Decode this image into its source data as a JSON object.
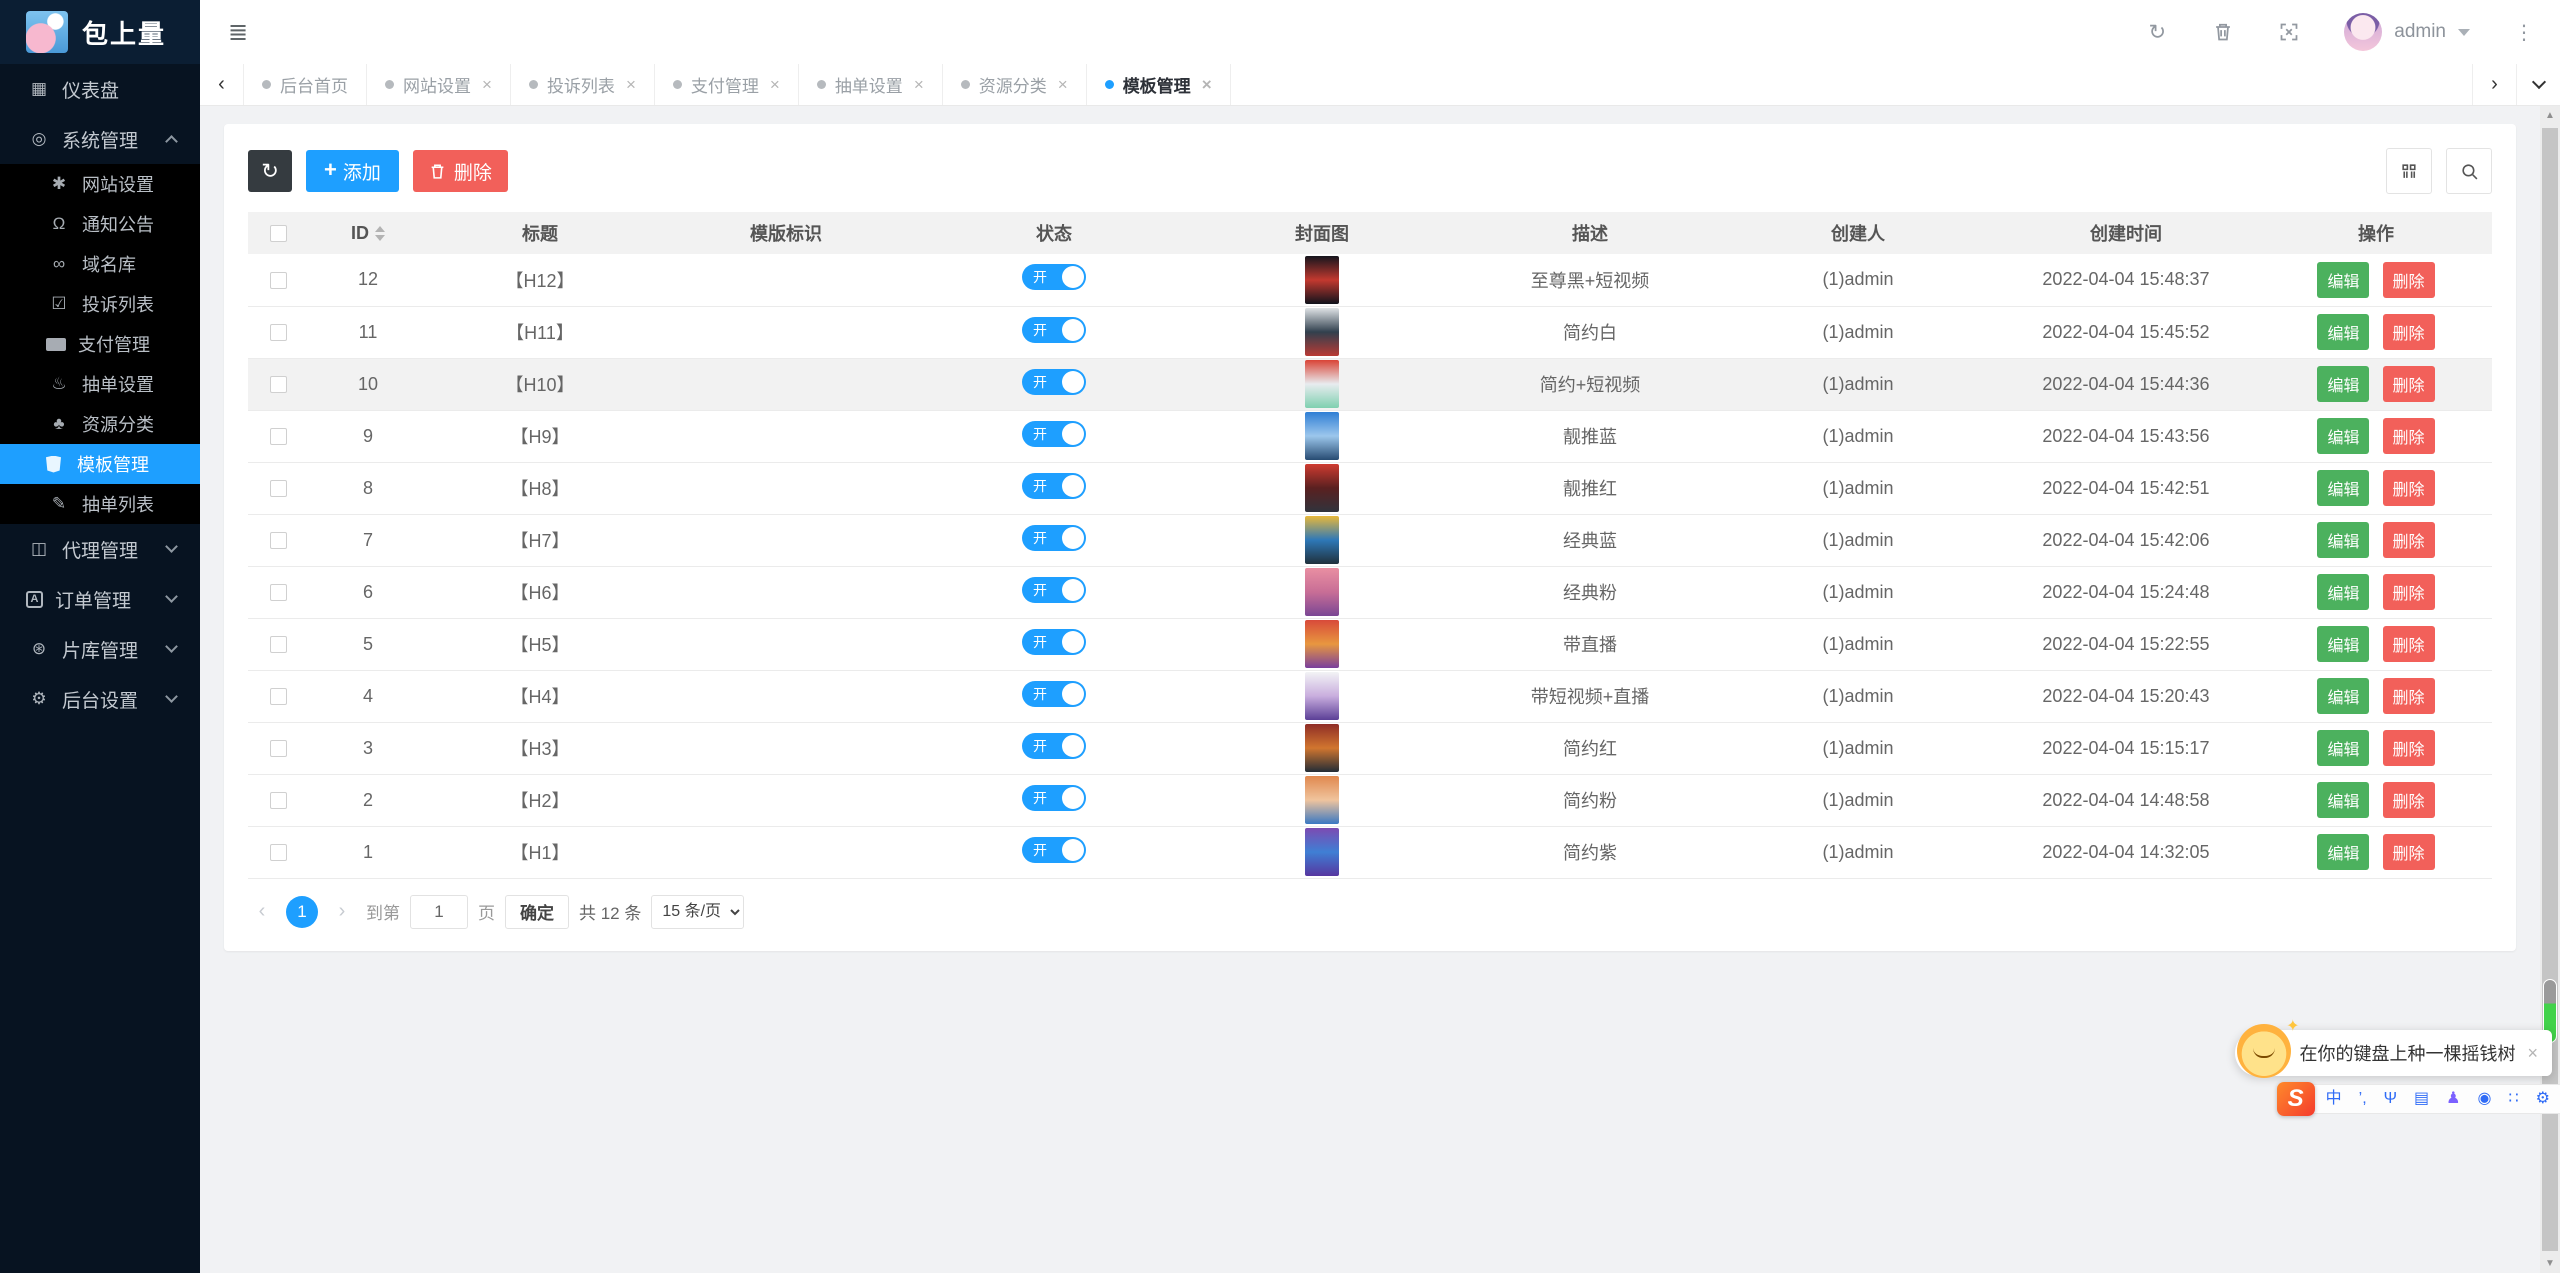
{
  "app": {
    "title": "包上量"
  },
  "colors": {
    "accent": "#1E9FFF",
    "success": "#4cb15e",
    "danger": "#f2605a",
    "dark_button": "#353b40",
    "sidebar_bg": "#071321",
    "toggle_on": "#1E9FFF"
  },
  "sidebar": {
    "logo_title": "包上量",
    "items": [
      {
        "key": "dashboard",
        "label": "仪表盘",
        "icon": "dashboard-icon",
        "type": "top"
      },
      {
        "key": "system",
        "label": "系统管理",
        "icon": "system-icon",
        "type": "group",
        "arrow": "up"
      },
      {
        "key": "website",
        "label": "网站设置",
        "icon": "website-icon",
        "type": "sub"
      },
      {
        "key": "notice",
        "label": "通知公告",
        "icon": "bell-icon",
        "type": "sub"
      },
      {
        "key": "domain",
        "label": "域名库",
        "icon": "link-icon",
        "type": "sub"
      },
      {
        "key": "complaint",
        "label": "投诉列表",
        "icon": "check-square-icon",
        "type": "sub"
      },
      {
        "key": "payment",
        "label": "支付管理",
        "icon": "paypal-icon",
        "type": "sub"
      },
      {
        "key": "draw-settings",
        "label": "抽单设置",
        "icon": "cake-icon",
        "type": "sub"
      },
      {
        "key": "resource",
        "label": "资源分类",
        "icon": "leaf-icon",
        "type": "sub"
      },
      {
        "key": "template",
        "label": "模板管理",
        "icon": "shield-icon",
        "type": "sub",
        "active": true
      },
      {
        "key": "draw-list",
        "label": "抽单列表",
        "icon": "wand-icon",
        "type": "sub"
      },
      {
        "key": "agent",
        "label": "代理管理",
        "icon": "address-book-icon",
        "type": "group",
        "arrow": "down"
      },
      {
        "key": "order",
        "label": "订单管理",
        "icon": "order-a-icon",
        "type": "group",
        "arrow": "down"
      },
      {
        "key": "library",
        "label": "片库管理",
        "icon": "film-mesh-icon",
        "type": "group",
        "arrow": "down"
      },
      {
        "key": "backend",
        "label": "后台设置",
        "icon": "gears-icon",
        "type": "group",
        "arrow": "down"
      }
    ]
  },
  "topbar": {
    "username": "admin"
  },
  "tabs": [
    {
      "label": "后台首页",
      "closable": false,
      "active": false
    },
    {
      "label": "网站设置",
      "closable": true,
      "active": false
    },
    {
      "label": "投诉列表",
      "closable": true,
      "active": false
    },
    {
      "label": "支付管理",
      "closable": true,
      "active": false
    },
    {
      "label": "抽单设置",
      "closable": true,
      "active": false
    },
    {
      "label": "资源分类",
      "closable": true,
      "active": false
    },
    {
      "label": "模板管理",
      "closable": true,
      "active": true
    }
  ],
  "toolbar": {
    "add_label": "添加",
    "delete_label": "删除"
  },
  "table": {
    "columns": [
      "ID",
      "标题",
      "模版标识",
      "状态",
      "封面图",
      "描述",
      "创建人",
      "创建时间",
      "操作"
    ],
    "switch_on_label": "开",
    "edit_label": "编辑",
    "delete_label": "删除",
    "rows": [
      {
        "id": "12",
        "title": "【H12】",
        "template_key": "",
        "status": "on",
        "desc": "至尊黑+短视频",
        "creator": "(1)admin",
        "created": "2022-04-04 15:48:37",
        "cover": [
          "#15151d",
          "#c3392f",
          "#10131c"
        ]
      },
      {
        "id": "11",
        "title": "【H11】",
        "template_key": "",
        "status": "on",
        "desc": "简约白",
        "creator": "(1)admin",
        "created": "2022-04-04 15:45:52",
        "cover": [
          "#dfe3e6",
          "#31404e",
          "#b93a34"
        ]
      },
      {
        "id": "10",
        "title": "【H10】",
        "template_key": "",
        "status": "on",
        "desc": "简约+短视频",
        "creator": "(1)admin",
        "created": "2022-04-04 15:44:36",
        "cover": [
          "#d94436",
          "#e8ecef",
          "#7fd0b0"
        ],
        "highlighted": true
      },
      {
        "id": "9",
        "title": "【H9】",
        "template_key": "",
        "status": "on",
        "desc": "靓推蓝",
        "creator": "(1)admin",
        "created": "2022-04-04 15:43:56",
        "cover": [
          "#2f7fd4",
          "#9cc7ec",
          "#274b72"
        ]
      },
      {
        "id": "8",
        "title": "【H8】",
        "template_key": "",
        "status": "on",
        "desc": "靓推红",
        "creator": "(1)admin",
        "created": "2022-04-04 15:42:51",
        "cover": [
          "#cf3b30",
          "#5a2020",
          "#30333c"
        ]
      },
      {
        "id": "7",
        "title": "【H7】",
        "template_key": "",
        "status": "on",
        "desc": "经典蓝",
        "creator": "(1)admin",
        "created": "2022-04-04 15:42:06",
        "cover": [
          "#e8b83a",
          "#2e78b8",
          "#20303c"
        ]
      },
      {
        "id": "6",
        "title": "【H6】",
        "template_key": "",
        "status": "on",
        "desc": "经典粉",
        "creator": "(1)admin",
        "created": "2022-04-04 15:24:48",
        "cover": [
          "#e98fa2",
          "#c86e96",
          "#7a4694"
        ]
      },
      {
        "id": "5",
        "title": "【H5】",
        "template_key": "",
        "status": "on",
        "desc": "带直播",
        "creator": "(1)admin",
        "created": "2022-04-04 15:22:55",
        "cover": [
          "#d84a3a",
          "#e8973f",
          "#7a3f9d"
        ]
      },
      {
        "id": "4",
        "title": "【H4】",
        "template_key": "",
        "status": "on",
        "desc": "带短视频+直播",
        "creator": "(1)admin",
        "created": "2022-04-04 15:20:43",
        "cover": [
          "#f2f3f5",
          "#c9aede",
          "#5b3f96"
        ]
      },
      {
        "id": "3",
        "title": "【H3】",
        "template_key": "",
        "status": "on",
        "desc": "简约红",
        "creator": "(1)admin",
        "created": "2022-04-04 15:15:17",
        "cover": [
          "#8f2d26",
          "#d1762f",
          "#232c36"
        ]
      },
      {
        "id": "2",
        "title": "【H2】",
        "template_key": "",
        "status": "on",
        "desc": "简约粉",
        "creator": "(1)admin",
        "created": "2022-04-04 14:48:58",
        "cover": [
          "#e0884e",
          "#f0c49d",
          "#3a78c2"
        ]
      },
      {
        "id": "1",
        "title": "【H1】",
        "template_key": "",
        "status": "on",
        "desc": "简约紫",
        "creator": "(1)admin",
        "created": "2022-04-04 14:32:05",
        "cover": [
          "#7c4bb2",
          "#3f7fd4",
          "#5636a0"
        ]
      }
    ]
  },
  "pagination": {
    "current_page": "1",
    "goto_label": "到第",
    "page_input": "1",
    "page_unit": "页",
    "confirm_label": "确定",
    "total_label": "共 12 条",
    "per_page_label": "15 条/页"
  },
  "ime": {
    "tooltip": "在你的键盘上种一棵摇钱树",
    "logo": "S",
    "icons": [
      "chinese-mode-icon",
      "punctuation-icon",
      "voice-icon",
      "keyboard-icon",
      "skin-icon",
      "game-icon",
      "apps-icon",
      "settings-icon"
    ]
  }
}
